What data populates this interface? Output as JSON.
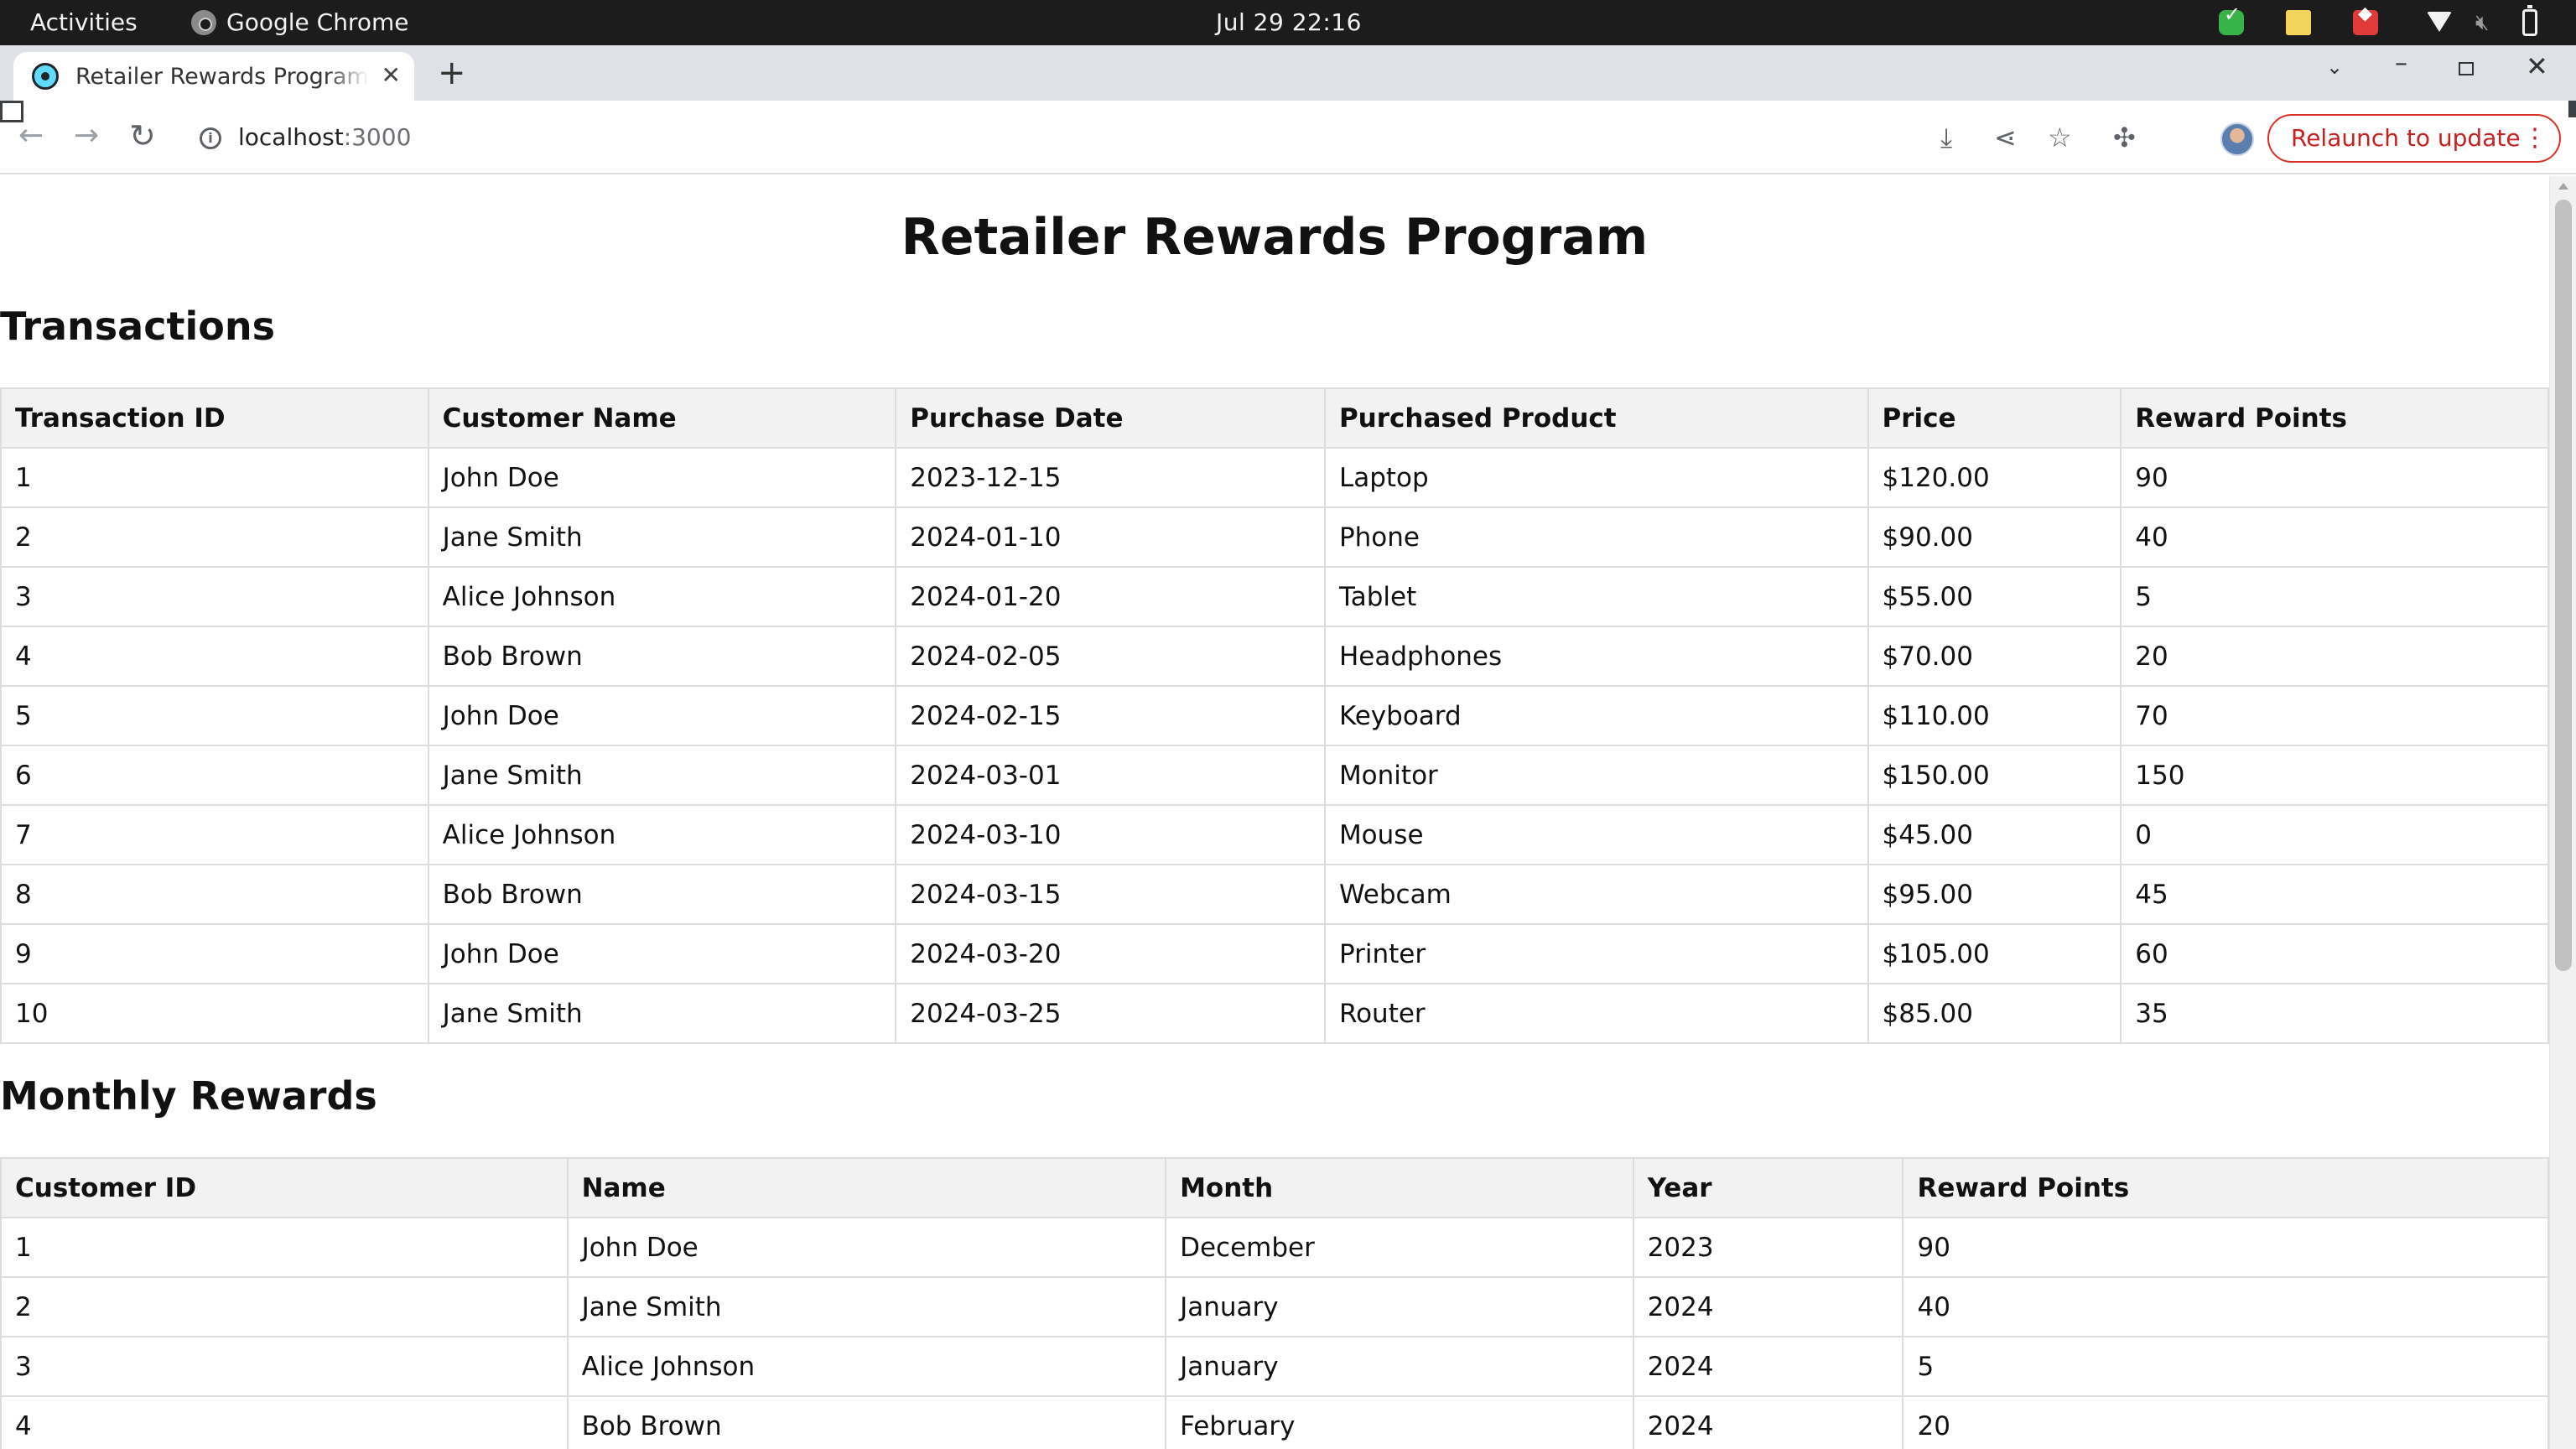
{
  "system_bar": {
    "activities": "Activities",
    "app_name": "Google Chrome",
    "clock": "Jul 29  22:16"
  },
  "browser": {
    "tab_title": "Retailer Rewards Program",
    "url_host": "localhost",
    "url_port": ":3000",
    "relaunch_label": "Relaunch to update",
    "accent_color": "#d93025"
  },
  "page": {
    "title": "Retailer Rewards Program",
    "transactions": {
      "title": "Transactions",
      "headers": [
        "Transaction ID",
        "Customer Name",
        "Purchase Date",
        "Purchased Product",
        "Price",
        "Reward Points"
      ],
      "rows": [
        [
          "1",
          "John Doe",
          "2023-12-15",
          "Laptop",
          "$120.00",
          "90"
        ],
        [
          "2",
          "Jane Smith",
          "2024-01-10",
          "Phone",
          "$90.00",
          "40"
        ],
        [
          "3",
          "Alice Johnson",
          "2024-01-20",
          "Tablet",
          "$55.00",
          "5"
        ],
        [
          "4",
          "Bob Brown",
          "2024-02-05",
          "Headphones",
          "$70.00",
          "20"
        ],
        [
          "5",
          "John Doe",
          "2024-02-15",
          "Keyboard",
          "$110.00",
          "70"
        ],
        [
          "6",
          "Jane Smith",
          "2024-03-01",
          "Monitor",
          "$150.00",
          "150"
        ],
        [
          "7",
          "Alice Johnson",
          "2024-03-10",
          "Mouse",
          "$45.00",
          "0"
        ],
        [
          "8",
          "Bob Brown",
          "2024-03-15",
          "Webcam",
          "$95.00",
          "45"
        ],
        [
          "9",
          "John Doe",
          "2024-03-20",
          "Printer",
          "$105.00",
          "60"
        ],
        [
          "10",
          "Jane Smith",
          "2024-03-25",
          "Router",
          "$85.00",
          "35"
        ]
      ]
    },
    "monthly_rewards": {
      "title": "Monthly Rewards",
      "headers": [
        "Customer ID",
        "Name",
        "Month",
        "Year",
        "Reward Points"
      ],
      "rows": [
        [
          "1",
          "John Doe",
          "December",
          "2023",
          "90"
        ],
        [
          "2",
          "Jane Smith",
          "January",
          "2024",
          "40"
        ],
        [
          "3",
          "Alice Johnson",
          "January",
          "2024",
          "5"
        ],
        [
          "4",
          "Bob Brown",
          "February",
          "2024",
          "20"
        ]
      ]
    }
  }
}
